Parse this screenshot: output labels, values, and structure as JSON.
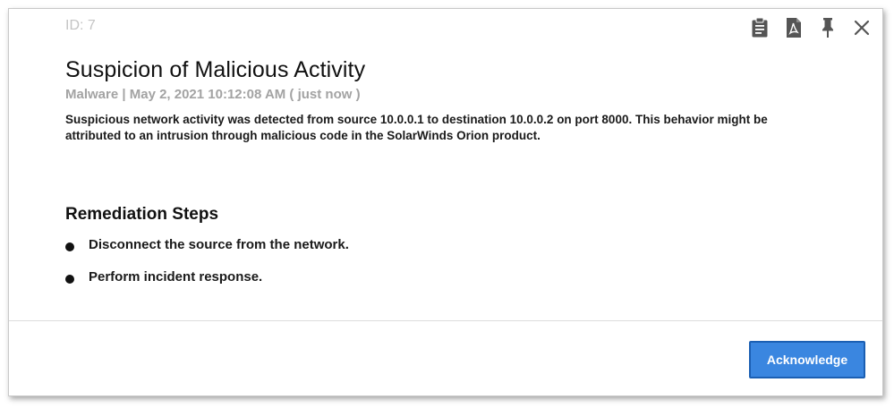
{
  "alert": {
    "id_label": "ID: 7",
    "title": "Suspicion of Malicious Activity",
    "meta": "Malware | May 2, 2021 10:12:08 AM ( just now )",
    "description": "Suspicious network activity was detected from source 10.0.0.1 to destination 10.0.0.2 on port 8000. This behavior might be attributed to an intrusion through malicious code in the SolarWinds Orion product."
  },
  "toolbar": {
    "icons": [
      "clipboard-icon",
      "pdf-icon",
      "pin-icon",
      "close-icon"
    ]
  },
  "remediation": {
    "heading": "Remediation Steps",
    "steps": [
      "Disconnect the source from the network.",
      "Perform incident response."
    ]
  },
  "footer": {
    "acknowledge_label": "Acknowledge"
  },
  "colors": {
    "accent": "#3a86e0",
    "accent_border": "#1b5fb3",
    "muted_text": "#a3a3a3",
    "icon": "#555555"
  }
}
